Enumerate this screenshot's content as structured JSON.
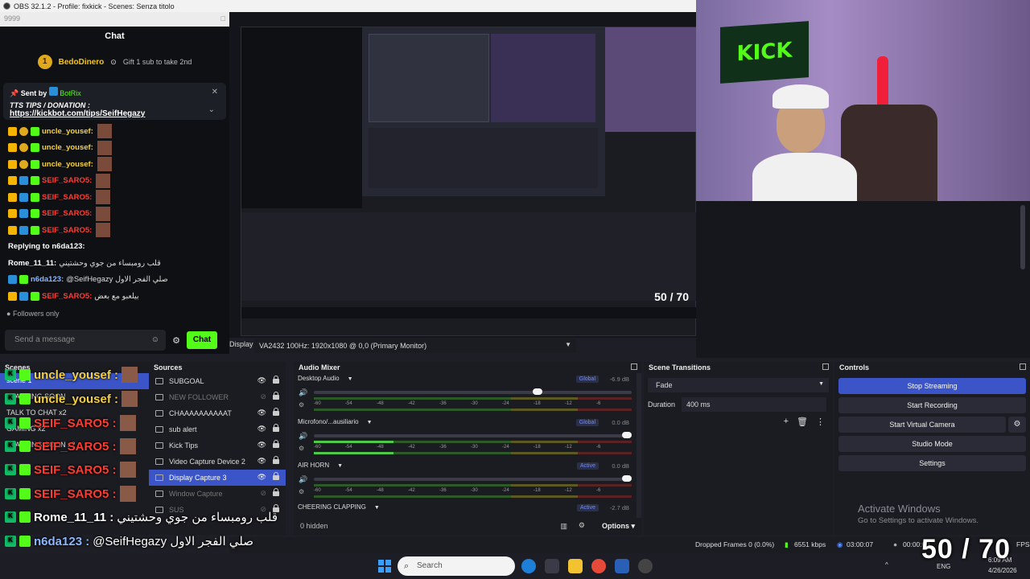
{
  "window": {
    "title": "OBS 32.1.2 - Profile: fixkick - Scenes: Senza titolo"
  },
  "chat": {
    "search_value": "9999",
    "title": "Chat",
    "sub_gift": {
      "user": "BedoDinero",
      "count": "1",
      "text": "Gift 1 sub to take 2nd"
    },
    "pinned": {
      "sent_by_label": "Sent by",
      "bot": "BotRix",
      "title": "TTS TIPS / DONATION :",
      "link": "https://kickbot.com/tips/SeifHegazy"
    },
    "messages": [
      {
        "user": "uncle_yousef:",
        "color": "yellow",
        "text": ""
      },
      {
        "user": "uncle_yousef:",
        "color": "yellow",
        "text": ""
      },
      {
        "user": "uncle_yousef:",
        "color": "yellow",
        "text": ""
      },
      {
        "user": "SEIF_SARO5:",
        "color": "red",
        "text": ""
      },
      {
        "user": "SEIF_SARO5:",
        "color": "red",
        "text": ""
      },
      {
        "user": "SEIF_SARO5:",
        "color": "red",
        "text": ""
      },
      {
        "user": "SEIF_SARO5:",
        "color": "red",
        "text": ""
      },
      {
        "user": "Replying to n6da123:",
        "color": "white",
        "text": ""
      },
      {
        "user": "Rome_11_11:",
        "color": "white",
        "text": "قلب رومبساء من جوي وحشتيني"
      },
      {
        "user": "n6da123:",
        "color": "blue",
        "text": "@SeifHegazy صلي الفجر الاول"
      },
      {
        "user": "SEIF_SARO5:",
        "color": "red",
        "text": "بيلعبو مع بعض"
      }
    ],
    "followers_only": "Followers only",
    "send_placeholder": "Send a message",
    "chat_button": "Chat"
  },
  "preview": {
    "display_label": "Display",
    "display_value": "VA2432 100Hz: 1920x1080 @ 0,0 (Primary Monitor)",
    "nested_counter": "50 / 70"
  },
  "camera": {
    "banner_text": "KICK"
  },
  "scenes": {
    "title": "Scenes",
    "items": [
      "scene 1",
      "STARTING SOON",
      "TALK TO CHAT x2",
      "GAMING x2",
      "STARTING SOON x2"
    ]
  },
  "sources": {
    "title": "Sources",
    "items": [
      {
        "name": "SUBGOAL",
        "visible": true,
        "active": false,
        "dim": false
      },
      {
        "name": "NEW FOLLOWER",
        "visible": false,
        "active": false,
        "dim": true
      },
      {
        "name": "CHAAAAAAAAAAT",
        "visible": true,
        "active": false,
        "dim": false
      },
      {
        "name": "sub alert",
        "visible": true,
        "active": false,
        "dim": false
      },
      {
        "name": "Kick Tips",
        "visible": true,
        "active": false,
        "dim": false
      },
      {
        "name": "Video Capture Device 2",
        "visible": true,
        "active": false,
        "dim": false
      },
      {
        "name": "Display Capture 3",
        "visible": true,
        "active": true,
        "dim": false
      },
      {
        "name": "Window Capture",
        "visible": false,
        "active": false,
        "dim": true
      },
      {
        "name": "SUS",
        "visible": false,
        "active": false,
        "dim": true
      }
    ]
  },
  "audio_mixer": {
    "title": "Audio Mixer",
    "scale": [
      "-60",
      "-54",
      "-48",
      "-42",
      "-36",
      "-30",
      "-24",
      "-18",
      "-12",
      "-6"
    ],
    "channels": [
      {
        "name": "Desktop Audio",
        "tag": "Global",
        "db": "-6.9 dB",
        "volume": 0.72,
        "level": 0.0
      },
      {
        "name": "Microfono/...ausiliario",
        "tag": "Global",
        "db": "0.0 dB",
        "volume": 1.0,
        "level": 0.25
      },
      {
        "name": "AIR HORN",
        "tag": "Active",
        "db": "0.0 dB",
        "volume": 1.0,
        "level": 0.0
      },
      {
        "name": "CHEERING CLAPPING",
        "tag": "Active",
        "db": "-2.7 dB",
        "volume": 0.95,
        "level": 0.0
      }
    ],
    "hidden_text": "0 hidden",
    "options_label": "Options"
  },
  "transitions": {
    "title": "Scene Transitions",
    "selected": "Fade",
    "duration_label": "Duration",
    "duration_value": "400 ms"
  },
  "controls": {
    "title": "Controls",
    "stop_streaming": "Stop Streaming",
    "start_recording": "Start Recording",
    "start_virtual_camera": "Start Virtual Camera",
    "studio_mode": "Studio Mode",
    "settings": "Settings"
  },
  "activate_windows": {
    "title": "Activate Windows",
    "subtitle": "Go to Settings to activate Windows."
  },
  "overlay_chat": [
    {
      "user": "uncle_yousef :",
      "color": "#f5d142",
      "text": ""
    },
    {
      "user": "uncle_yousef :",
      "color": "#f5d142",
      "text": ""
    },
    {
      "user": "SEIF_SARO5 :",
      "color": "#ff3b30",
      "text": ""
    },
    {
      "user": "SEIF_SARO5 :",
      "color": "#ff3b30",
      "text": ""
    },
    {
      "user": "SEIF_SARO5 :",
      "color": "#ff3b30",
      "text": ""
    },
    {
      "user": "SEIF_SARO5 :",
      "color": "#ff3b30",
      "text": ""
    },
    {
      "user": "Rome_11_11 :",
      "color": "#ffffff",
      "text": "قلب رومبساء من جوي وحشتيني"
    },
    {
      "user": "n6da123 :",
      "color": "#8bb7ff",
      "text": "@SeifHegazy صلي الفجر الاول"
    },
    {
      "user": "SEIF_SARO5 :",
      "color": "#ff3b30",
      "text": "بيلعبو مع بعض"
    }
  ],
  "status": {
    "dropped_frames": "Dropped Frames 0 (0.0%)",
    "bitrate": "6551 kbps",
    "stream_time": "03:00:07",
    "rec_time": "00:00:00",
    "fps": "FPS"
  },
  "counter": "50 / 70",
  "taskbar": {
    "search_placeholder": "Search",
    "lang": "ENG",
    "time": "6:09 AM",
    "date": "4/26/2026"
  },
  "colors": {
    "accent": "#3b55c9",
    "kick_green": "#53fc18"
  }
}
